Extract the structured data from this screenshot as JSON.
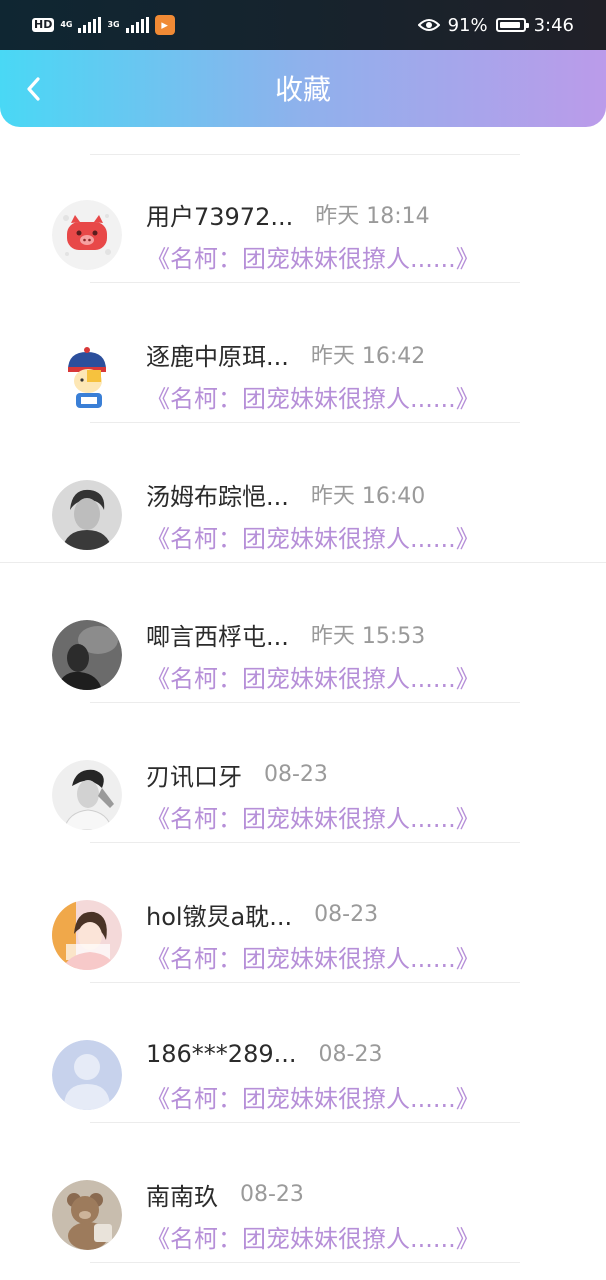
{
  "status_bar": {
    "hd": "HD",
    "net1": "4G",
    "net2": "3G",
    "battery_percent": "91%",
    "battery_level": 0.91,
    "time": "3:46",
    "icons": [
      "hd-icon",
      "signal-icon",
      "signal-icon",
      "app-notification-icon",
      "eye-icon",
      "battery-icon"
    ]
  },
  "header": {
    "title": "收藏",
    "back_icon": "back-chevron-icon"
  },
  "favorites": [
    {
      "name": "用户73972...",
      "time": "昨天 18:14",
      "title": "《名柯：团宠妹妹很撩人......》",
      "avatar": "pig-avatar"
    },
    {
      "name": "逐鹿中原珥...",
      "time": "昨天 16:42",
      "title": "《名柯：团宠妹妹很撩人......》",
      "avatar": "cartoon-avatar"
    },
    {
      "name": "汤姆布踪悒...",
      "time": "昨天 16:40",
      "title": "《名柯：团宠妹妹很撩人......》",
      "avatar": "photo-avatar"
    },
    {
      "name": "唧言西桴屯...",
      "time": "昨天 15:53",
      "title": "《名柯：团宠妹妹很撩人......》",
      "avatar": "photo-avatar"
    },
    {
      "name": "刃讯口牙",
      "time": "08-23",
      "title": "《名柯：团宠妹妹很撩人......》",
      "avatar": "photo-avatar"
    },
    {
      "name": "hol镦炅a耽...",
      "time": "08-23",
      "title": "《名柯：团宠妹妹很撩人......》",
      "avatar": "photo-avatar"
    },
    {
      "name": "186***289...",
      "time": "08-23",
      "title": "《名柯：团宠妹妹很撩人......》",
      "avatar": "default-user-avatar"
    },
    {
      "name": "南南玖",
      "time": "08-23",
      "title": "《名柯：团宠妹妹很撩人......》",
      "avatar": "teddy-bear-avatar"
    }
  ]
}
